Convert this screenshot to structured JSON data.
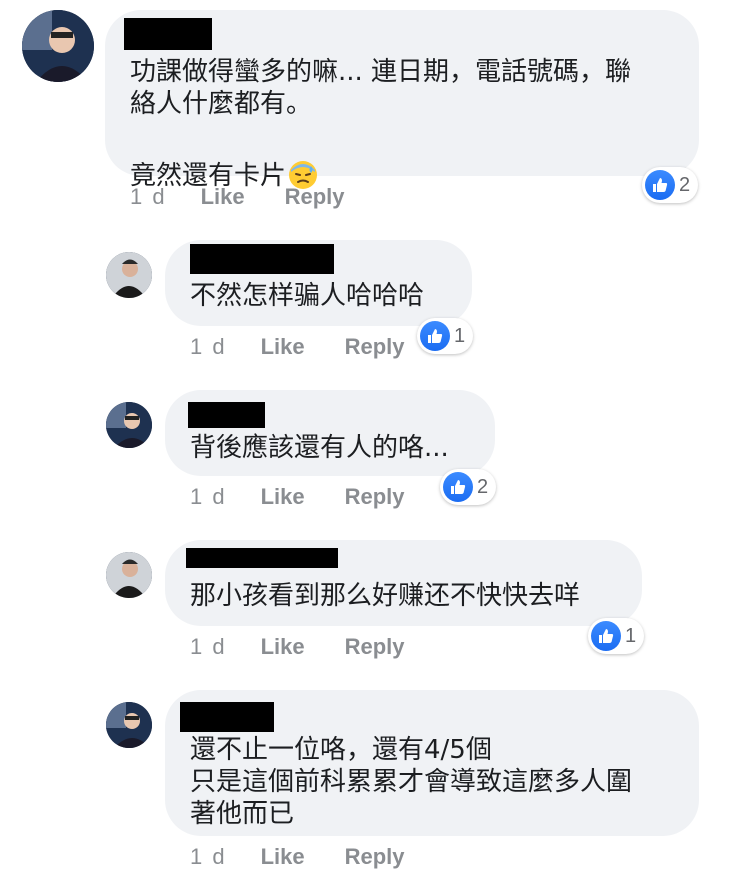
{
  "comments": [
    {
      "text": "功課做得蠻多的嘛... 連日期，電話號碼，聯\n絡人什麼都有。",
      "text2": "竟然還有卡片",
      "emoji": "downcast-face-with-sweat-icon",
      "time": "1 d",
      "like": "Like",
      "reply": "Reply",
      "reactions": "2"
    },
    {
      "text": "不然怎样骗人哈哈哈",
      "time": "1 d",
      "like": "Like",
      "reply": "Reply",
      "reactions": "1"
    },
    {
      "text": "背後應該還有人的咯...",
      "time": "1 d",
      "like": "Like",
      "reply": "Reply",
      "reactions": "2"
    },
    {
      "text": "那小孩看到那么好赚还不快快去咩",
      "time": "1 d",
      "like": "Like",
      "reply": "Reply",
      "reactions": "1"
    },
    {
      "text": "還不止一位咯，還有4/5個\n只是這個前科累累才會導致這麼多人圍\n著他而已",
      "time": "1 d",
      "like": "Like",
      "reply": "Reply"
    }
  ],
  "colors": {
    "bubble": "#f0f2f5",
    "meta": "#8a8d91",
    "like_blue": "#1b6cf2",
    "redaction": "#000000"
  }
}
